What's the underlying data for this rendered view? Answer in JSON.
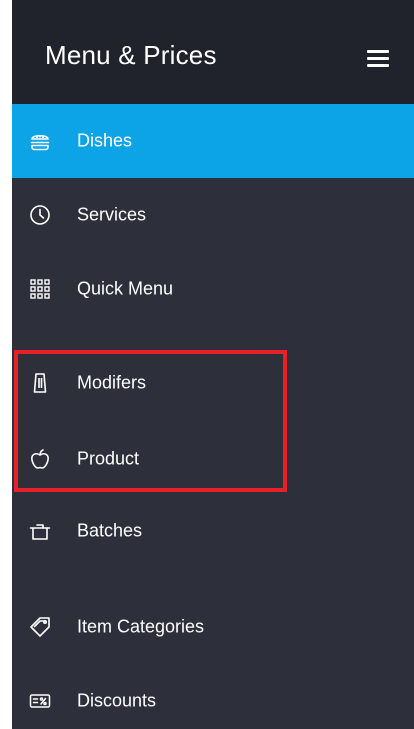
{
  "header": {
    "title": "Menu & Prices",
    "menu_icon": "hamburger-icon"
  },
  "nav": {
    "items": [
      {
        "label": "Dishes",
        "icon": "burger-icon",
        "active": true
      },
      {
        "label": "Services",
        "icon": "clock-icon"
      },
      {
        "label": "Quick Menu",
        "icon": "grid-icon"
      },
      {
        "label": "Modifers",
        "icon": "shaker-icon"
      },
      {
        "label": "Product",
        "icon": "apple-icon"
      },
      {
        "label": "Batches",
        "icon": "pot-icon"
      },
      {
        "label": "Item Categories",
        "icon": "tag-icon"
      },
      {
        "label": "Discounts",
        "icon": "discount-icon"
      }
    ]
  },
  "colors": {
    "header_bg": "#20232c",
    "panel_bg": "#2d303b",
    "active_bg": "#0ca3e7",
    "highlight_border": "#e8202a",
    "text": "#ffffff"
  }
}
